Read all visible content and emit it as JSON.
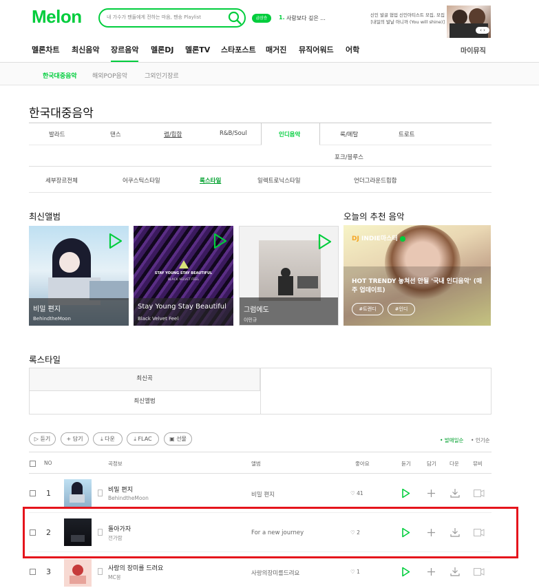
{
  "header": {
    "logo": "Melon",
    "search_placeholder": "내 가수가 팬들에게 전하는 마음, 팬송 Playlist",
    "live_badge": "급상승",
    "rank_num": "1.",
    "rank_text": "사랑보다 깊은 ...",
    "ad_line1": "신인 발굴 협업 신인아티스트 모집, 모집",
    "ad_line2": "[내일의 발날 아니까 (You will shine)]"
  },
  "gnb": {
    "items": [
      "멜론차트",
      "최신음악",
      "장르음악",
      "멜론DJ",
      "멜론TV",
      "스타포스트",
      "매거진",
      "뮤직어워드",
      "어학"
    ],
    "right": "마이뮤직"
  },
  "lnb": {
    "items": [
      "한국대중음악",
      "해외POP음악",
      "그외인기장르"
    ]
  },
  "page_title": "한국대중음악",
  "genres": {
    "row1": [
      "발라드",
      "댄스",
      "랩/힙합",
      "R&B/Soul",
      "인디음악",
      "록/메탈",
      "트로트"
    ],
    "row2": "포크/블루스",
    "sub": [
      "세부장르전체",
      "어쿠스틱스타일",
      "록스타일",
      "일렉트로닉스타일",
      "언더그라운드힙합"
    ]
  },
  "latest_albums": {
    "title": "최신앨범",
    "cards": [
      {
        "title": "비밀 편지",
        "artist": "BehindtheMoon"
      },
      {
        "title": "Stay Young Stay Beautiful",
        "artist": "Black Velvet Feel",
        "cover_line1": "STAY YOUNG STAY BEAUTIFUL",
        "cover_line2": "BLACK VELVET FEEL"
      },
      {
        "title": "그럼에도",
        "artist": "이민규"
      }
    ]
  },
  "recommend": {
    "title": "오늘의 추천 음악",
    "badge": "INDIE마스터",
    "text": "HOT TRENDY 놓쳐선 안될 '국내 인디음악' (매주 업데이트)",
    "tags": [
      "#트렌디",
      "#인디"
    ]
  },
  "style_section": {
    "title": "록스타일",
    "tabs": [
      "최신곡",
      "최신앨범"
    ]
  },
  "toolbar": {
    "buttons": [
      "듣기",
      "담기",
      "다운",
      "FLAC",
      "선물"
    ],
    "sort": [
      "발매일순",
      "인기순"
    ]
  },
  "table": {
    "headers": {
      "no": "NO",
      "song": "곡정보",
      "album": "앨범",
      "like": "좋아요",
      "listen": "듣기",
      "add": "담기",
      "down": "다운",
      "mv": "뮤비"
    },
    "rows": [
      {
        "no": "1",
        "title": "비밀 편지",
        "artist": "BehindtheMoon",
        "album": "비밀 편지",
        "likes": "41"
      },
      {
        "no": "2",
        "title": "돌아가자",
        "artist": "전가람",
        "album": "For a new journey",
        "likes": "2"
      },
      {
        "no": "3",
        "title": "사랑의 장미를 드려요",
        "artist": "MC몽",
        "album": "사랑의장미를드려요",
        "likes": "1"
      }
    ]
  },
  "colors": {
    "accent": "#00cd3c",
    "highlight": "#e5141c"
  }
}
